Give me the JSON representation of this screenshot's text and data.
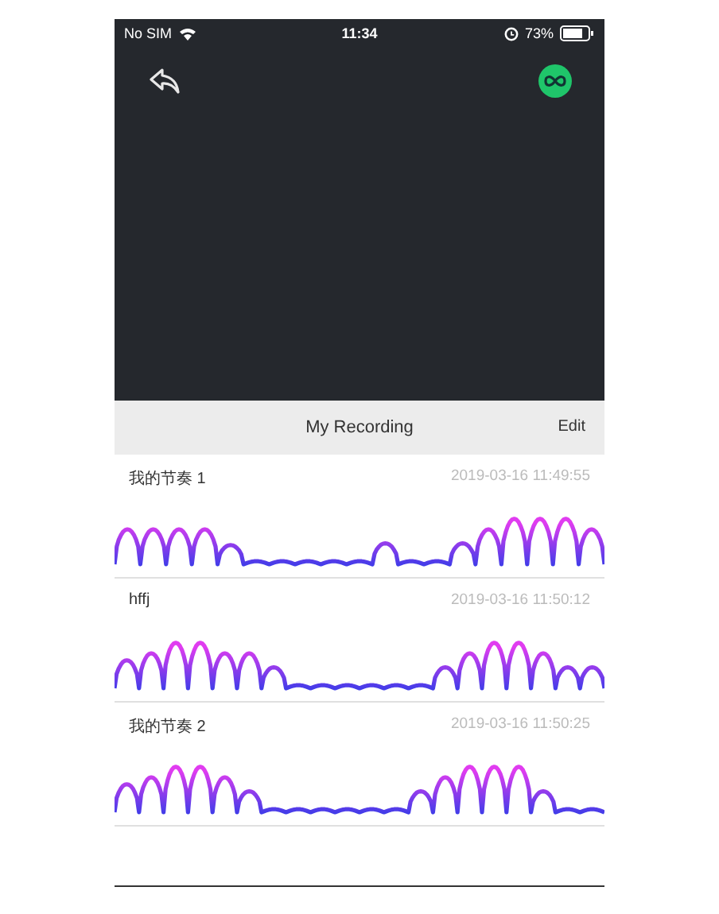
{
  "status_bar": {
    "carrier": "No SIM",
    "time": "11:34",
    "battery_percent": "73%"
  },
  "sheet": {
    "title": "My Recording",
    "edit": "Edit"
  },
  "recordings": [
    {
      "name": "我的节奏 1",
      "date": "2019-03-16 11:49:55"
    },
    {
      "name": "hffj",
      "date": "2019-03-16 11:50:12"
    },
    {
      "name": "我的节奏 2",
      "date": "2019-03-16 11:50:25"
    }
  ]
}
